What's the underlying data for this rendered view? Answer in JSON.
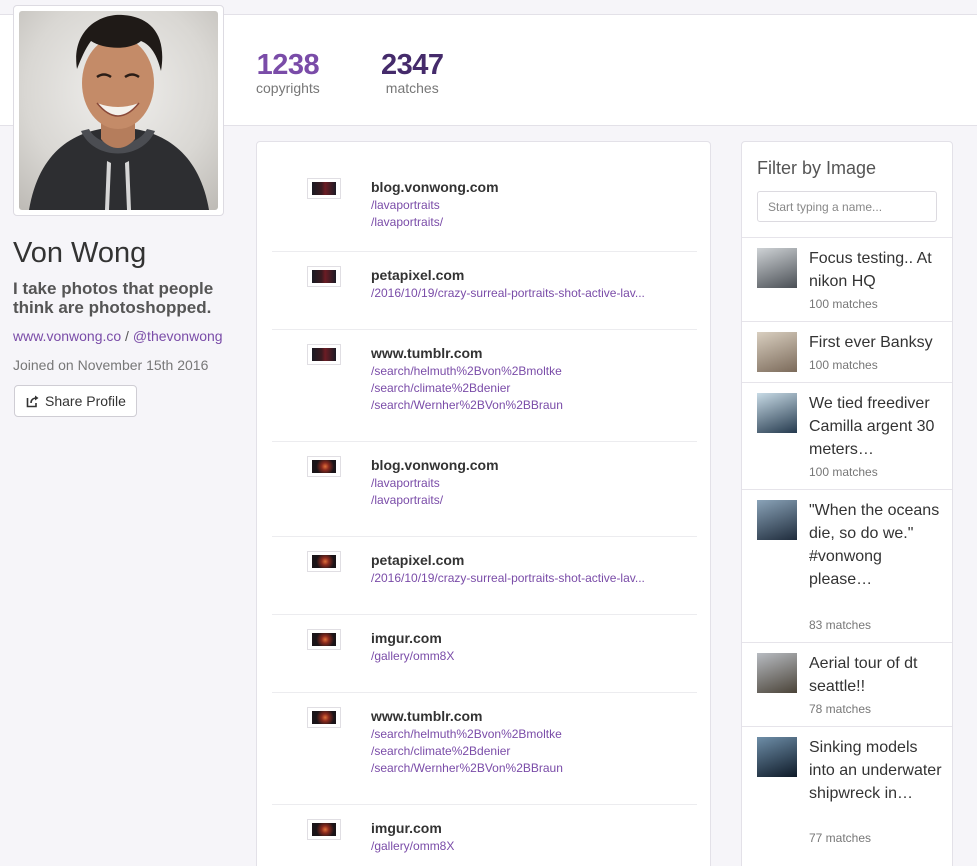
{
  "stats": {
    "copyrights_value": "1238",
    "copyrights_label": "copyrights",
    "matches_value": "2347",
    "matches_label": "matches"
  },
  "profile": {
    "name": "Von Wong",
    "bio": "I take photos that people think are photoshopped.",
    "website": "www.vonwong.co",
    "separator": " / ",
    "handle": "@thevonwong",
    "joined": "Joined on November 15th 2016",
    "share_label": "Share Profile",
    "colors": {
      "link": "#7a4ca8",
      "copyrights": "#7a4ca8",
      "matches": "#452b6b"
    }
  },
  "matches": [
    {
      "domain": "blog.vonwong.com",
      "paths": [
        "/lavaportraits",
        "/lavaportraits/"
      ],
      "thumb": "thumb-a"
    },
    {
      "domain": "petapixel.com",
      "paths": [
        "/2016/10/19/crazy-surreal-portraits-shot-active-lav..."
      ],
      "thumb": "thumb-a"
    },
    {
      "domain": "www.tumblr.com",
      "paths": [
        "/search/helmuth%2Bvon%2Bmoltke",
        "/search/climate%2Bdenier",
        "/search/Wernher%2BVon%2BBraun"
      ],
      "thumb": "thumb-a"
    },
    {
      "domain": "blog.vonwong.com",
      "paths": [
        "/lavaportraits",
        "/lavaportraits/"
      ],
      "thumb": "thumb-b"
    },
    {
      "domain": "petapixel.com",
      "paths": [
        "/2016/10/19/crazy-surreal-portraits-shot-active-lav..."
      ],
      "thumb": "thumb-b"
    },
    {
      "domain": "imgur.com",
      "paths": [
        "/gallery/omm8X"
      ],
      "thumb": "thumb-b"
    },
    {
      "domain": "www.tumblr.com",
      "paths": [
        "/search/helmuth%2Bvon%2Bmoltke",
        "/search/climate%2Bdenier",
        "/search/Wernher%2BVon%2BBraun"
      ],
      "thumb": "thumb-b"
    },
    {
      "domain": "imgur.com",
      "paths": [
        "/gallery/omm8X"
      ],
      "thumb": "thumb-b"
    }
  ],
  "filter": {
    "title": "Filter by Image",
    "placeholder": "Start typing a name...",
    "images": [
      {
        "title": "Focus testing.. At nikon HQ",
        "count": "100 matches",
        "colors": [
          "#cfd3d6",
          "#4a4f55"
        ]
      },
      {
        "title": "First ever Banksy",
        "count": "100 matches",
        "colors": [
          "#d9cfc0",
          "#7b6a5a"
        ]
      },
      {
        "title": "We tied freediver Camilla argent 30 meters…",
        "count": "100 matches",
        "colors": [
          "#c8dbe6",
          "#253a4e"
        ]
      },
      {
        "title": "\"When the oceans die, so do we.\" #vonwong please…",
        "count": "83 matches",
        "colors": [
          "#8aa3b8",
          "#1f2c3c"
        ]
      },
      {
        "title": "Aerial tour of dt seattle!!",
        "count": "78 matches",
        "colors": [
          "#b8bcc2",
          "#4a4338"
        ]
      },
      {
        "title": "Sinking models into an underwater shipwreck in…",
        "count": "77 matches",
        "colors": [
          "#6e8ea8",
          "#0e1a28"
        ]
      }
    ]
  }
}
